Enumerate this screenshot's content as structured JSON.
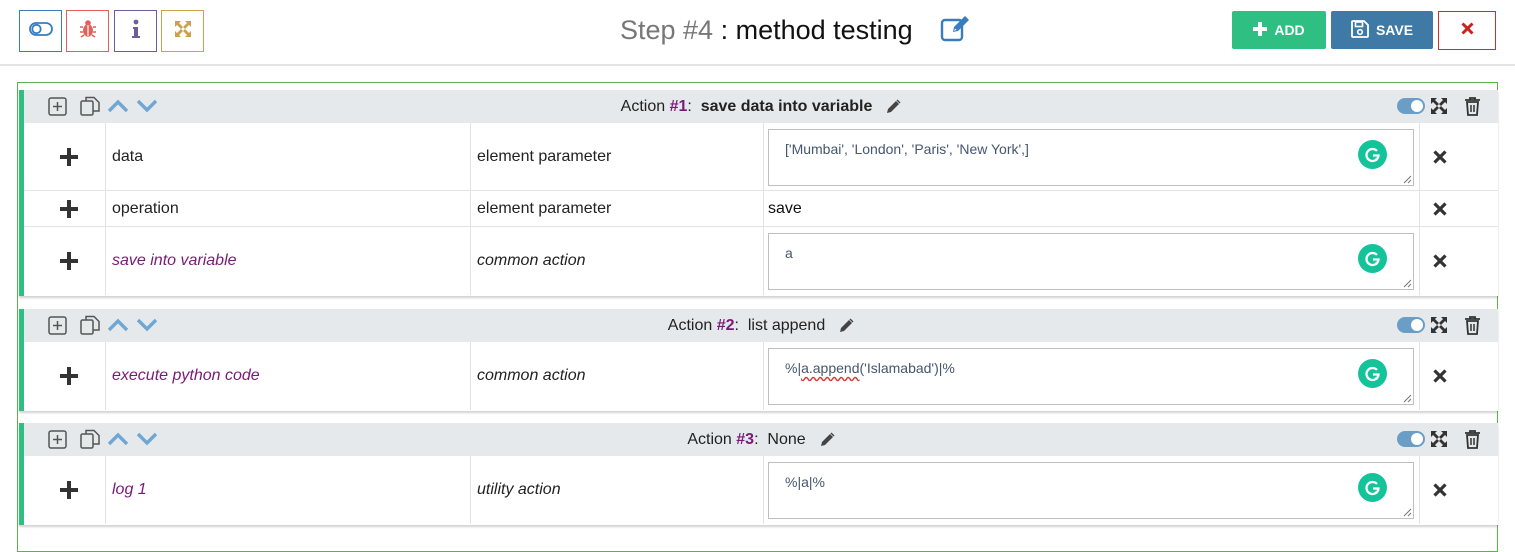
{
  "toolbar": {
    "left_icons": [
      "toggle-icon",
      "bug-icon",
      "info-icon",
      "expand-icon"
    ],
    "add_label": "ADD",
    "save_label": "SAVE"
  },
  "header": {
    "step_prefix": "Step #4",
    "separator": " : ",
    "step_name": "method testing"
  },
  "colors": {
    "add": "#2fbf83",
    "save": "#3f7aa6",
    "close": "#c9302c",
    "action_border": "#2fbf83",
    "action_number": "#7a1a78",
    "grammarly": "#15c39a"
  },
  "actions": [
    {
      "label": "Action",
      "number": "#1",
      "sep": ":",
      "name": "save data into variable",
      "name_bold": true,
      "rows": [
        {
          "name": "data",
          "type": "element parameter",
          "value": "['Mumbai', 'London', 'Paris', 'New York',]",
          "style": "plain"
        },
        {
          "name": "operation",
          "type": "element parameter",
          "value": "save",
          "style": "plain"
        },
        {
          "name": "save into variable",
          "type": "common action",
          "value": "a",
          "style": "italic"
        }
      ]
    },
    {
      "label": "Action",
      "number": "#2",
      "sep": ":",
      "name": "list append",
      "name_bold": false,
      "rows": [
        {
          "name": "execute python code",
          "type": "common action",
          "value_pre": "%|",
          "value_err": "a.append",
          "value_post": "('Islamabad')|%",
          "style": "italic"
        }
      ]
    },
    {
      "label": "Action",
      "number": "#3",
      "sep": ":",
      "name": "None",
      "name_bold": false,
      "rows": [
        {
          "name": "log 1",
          "type": "utility action",
          "value": "%|a|%",
          "style": "italic"
        }
      ]
    }
  ]
}
